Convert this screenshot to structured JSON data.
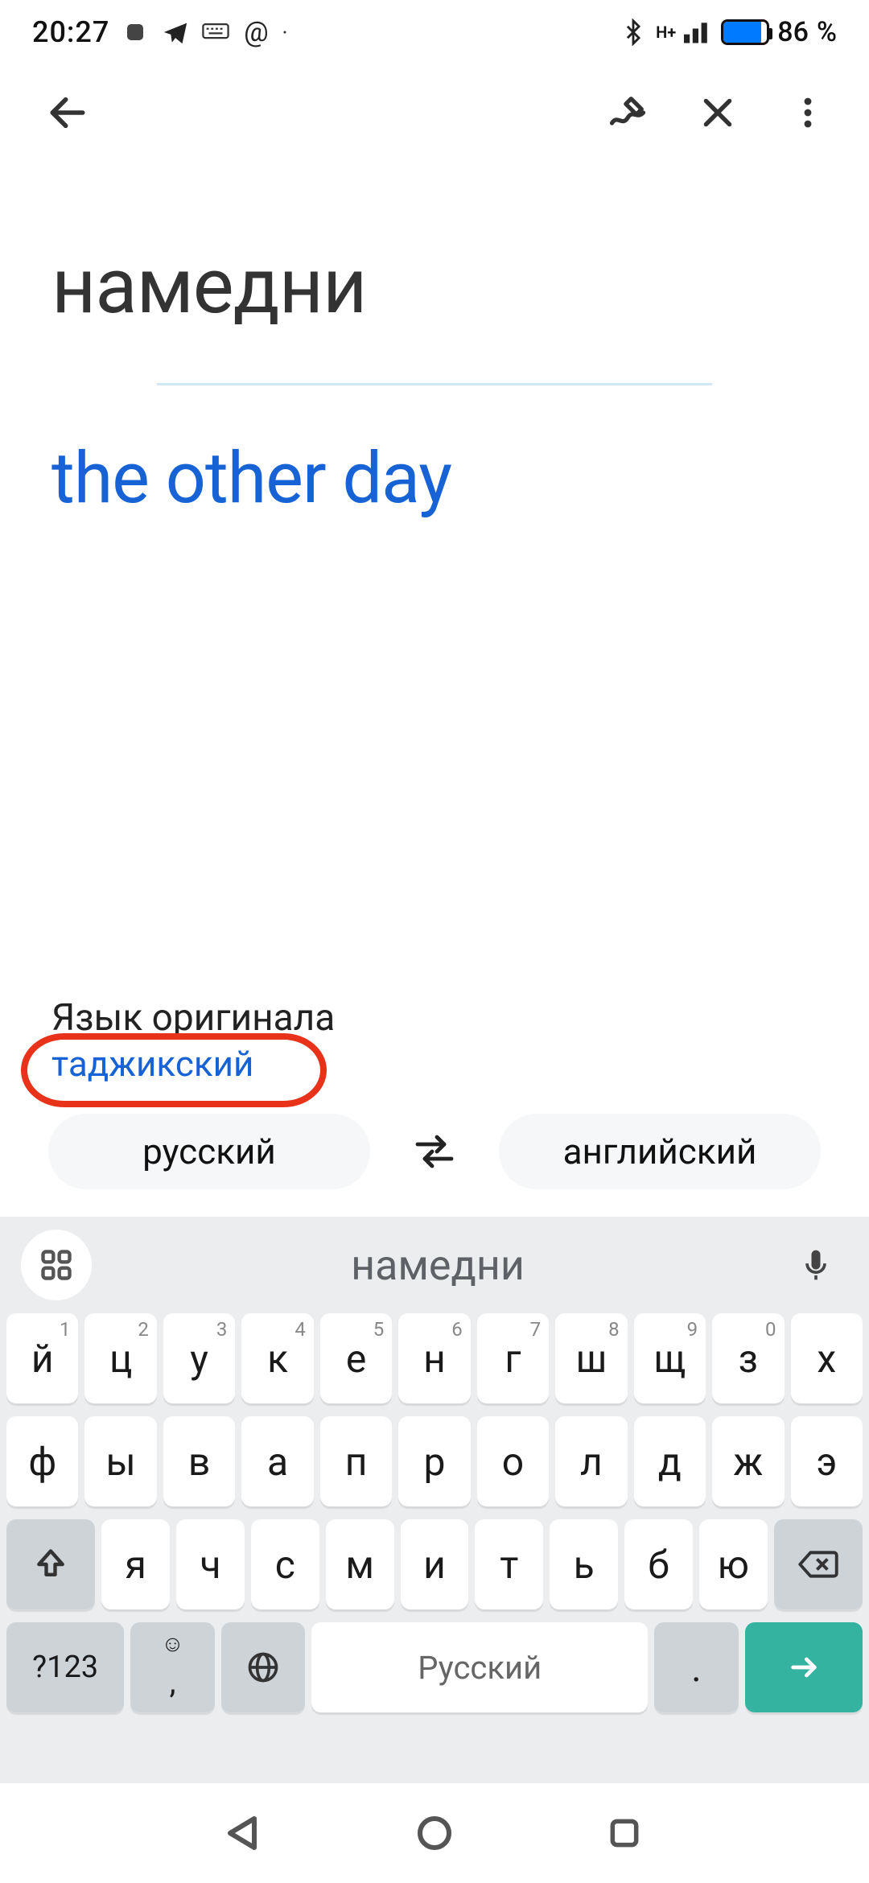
{
  "status": {
    "time": "20:27",
    "battery_percent": "86",
    "battery_suffix": "%"
  },
  "translate": {
    "source_text": "намедни",
    "target_text": "the other day",
    "original_lang_label": "Язык оригинала",
    "detected_language": "таджикский"
  },
  "lang_row": {
    "source": "русский",
    "target": "английский"
  },
  "keyboard": {
    "suggestion": "намедни",
    "row1": [
      {
        "main": "й",
        "hint": "1"
      },
      {
        "main": "ц",
        "hint": "2"
      },
      {
        "main": "у",
        "hint": "3"
      },
      {
        "main": "к",
        "hint": "4"
      },
      {
        "main": "е",
        "hint": "5"
      },
      {
        "main": "н",
        "hint": "6"
      },
      {
        "main": "г",
        "hint": "7"
      },
      {
        "main": "ш",
        "hint": "8"
      },
      {
        "main": "щ",
        "hint": "9"
      },
      {
        "main": "з",
        "hint": "0"
      },
      {
        "main": "х",
        "hint": ""
      }
    ],
    "row2": [
      {
        "main": "ф"
      },
      {
        "main": "ы"
      },
      {
        "main": "в"
      },
      {
        "main": "а"
      },
      {
        "main": "п"
      },
      {
        "main": "р"
      },
      {
        "main": "о"
      },
      {
        "main": "л"
      },
      {
        "main": "д"
      },
      {
        "main": "ж"
      },
      {
        "main": "э"
      }
    ],
    "row3": [
      {
        "main": "я"
      },
      {
        "main": "ч"
      },
      {
        "main": "с"
      },
      {
        "main": "м"
      },
      {
        "main": "и"
      },
      {
        "main": "т"
      },
      {
        "main": "ь"
      },
      {
        "main": "б"
      },
      {
        "main": "ю"
      }
    ],
    "row4": {
      "symbols": "?123",
      "comma": ",",
      "space": "Русский",
      "period": "."
    }
  }
}
